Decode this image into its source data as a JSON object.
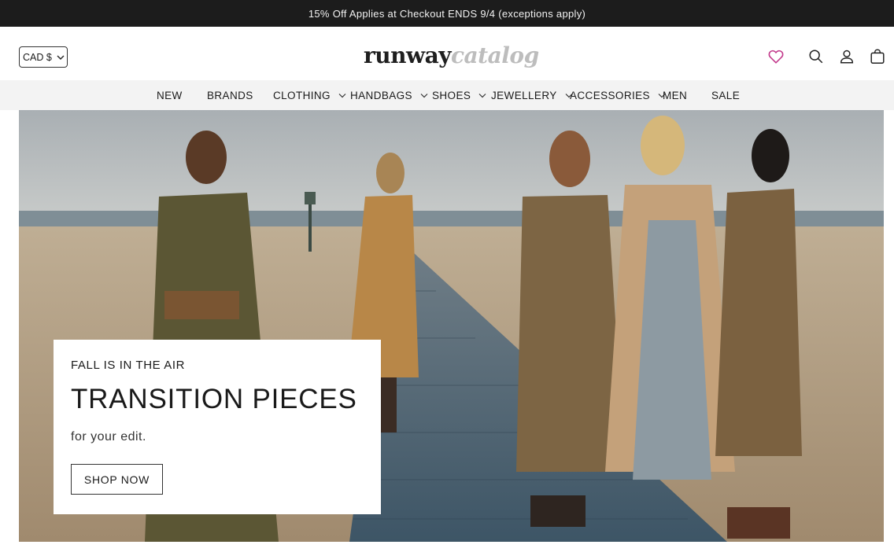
{
  "promo_bar": {
    "text": "15% Off Applies at Checkout ENDS 9/4 (exceptions apply)"
  },
  "header": {
    "currency": "CAD $",
    "logo_part1": "runway",
    "logo_part2": "catalog",
    "icons": [
      "heart-icon",
      "search-icon",
      "account-icon",
      "cart-icon"
    ],
    "wishlist_color": "#c2378a"
  },
  "nav": {
    "items": [
      {
        "label": "NEW",
        "has_dropdown": false
      },
      {
        "label": "BRANDS",
        "has_dropdown": false
      },
      {
        "label": "CLOTHING",
        "has_dropdown": true
      },
      {
        "label": "HANDBAGS",
        "has_dropdown": true
      },
      {
        "label": "SHOES",
        "has_dropdown": true
      },
      {
        "label": "JEWELLERY",
        "has_dropdown": true
      },
      {
        "label": "ACCESSORIES",
        "has_dropdown": true
      },
      {
        "label": "MEN",
        "has_dropdown": false
      },
      {
        "label": "SALE",
        "has_dropdown": false
      }
    ]
  },
  "hero": {
    "eyebrow": "FALL IS IN THE AIR",
    "headline": "TRANSITION PIECES",
    "subline": "for your edit.",
    "cta": "SHOP NOW"
  }
}
